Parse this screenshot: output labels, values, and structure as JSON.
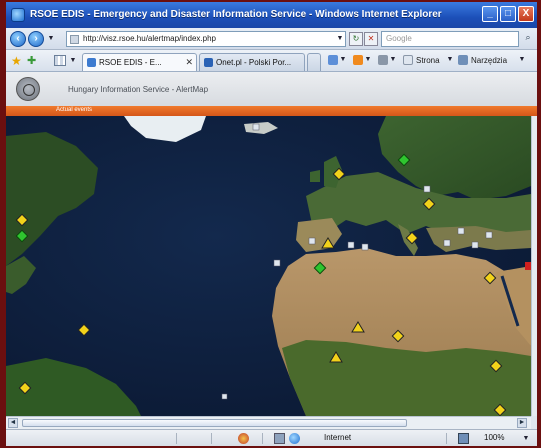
{
  "window": {
    "title": "RSOE EDIS - Emergency and Disaster Information Service - Windows Internet Explorer",
    "minimize_label": "_",
    "restore_label": "□",
    "close_label": "X"
  },
  "address": {
    "url": "http://visz.rsoe.hu/alertmap/index.php",
    "search_placeholder": "Google"
  },
  "tabs": [
    {
      "label": "RSOE EDIS - E...",
      "active": true
    },
    {
      "label": "Onet.pl - Polski Por...",
      "active": false
    }
  ],
  "commands": {
    "page_label": "Strona",
    "tools_label": "Narzędzia"
  },
  "page": {
    "header_title": "Hungary Information Service - AlertMap",
    "orange_bar_text": "Actual events"
  },
  "status": {
    "zone_label": "Internet",
    "zoom_label": "100%"
  },
  "colors": {
    "ocean": "#0e1e3a",
    "land_green": "#2f5a24",
    "desert": "#a88a5e",
    "marker_yellow": "#f2d21a",
    "marker_green": "#2fc42f",
    "accent_orange": "#e8681f"
  },
  "markers": [
    {
      "type": "yellow-diamond"
    },
    {
      "type": "green-diamond"
    },
    {
      "type": "yellow-triangle"
    },
    {
      "type": "white-square"
    }
  ]
}
